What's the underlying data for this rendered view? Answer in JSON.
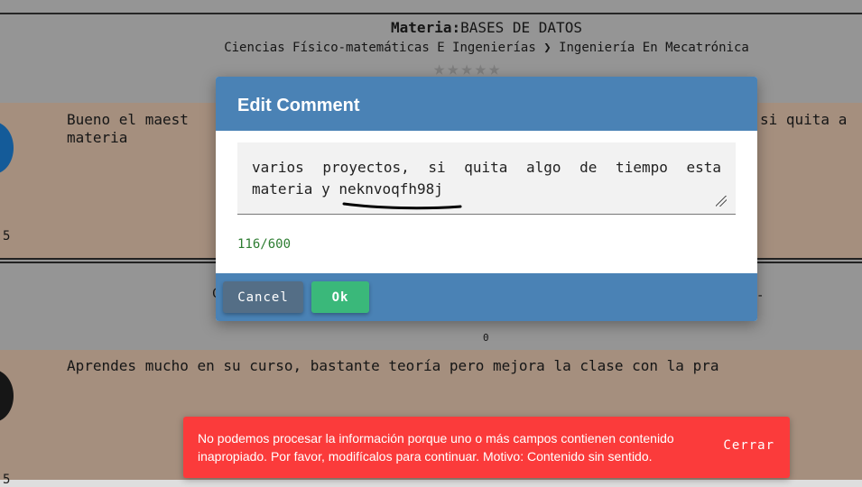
{
  "page": {
    "title_label": "Materia:",
    "title_value": "BASES DE DATOS",
    "breadcrumb_area": "Ciencias Físico-matemáticas E Ingenierías",
    "breadcrumb_sep": "❯",
    "breadcrumb_career": "Ingeniería En Mecatrónica",
    "stars": "★★★★★",
    "stars_filled": 0
  },
  "comments": [
    {
      "text_line1": "Bueno el maest",
      "text_line1_right": "si quita a",
      "text_line2": "materia",
      "rating": "5"
    },
    {
      "text_line1": "Aprendes mucho en su curso, bastante teoría pero mejora la clase con la pra",
      "rating": "5",
      "votes": "0"
    }
  ],
  "ghost": {
    "c": "C",
    "dash": "-"
  },
  "modal": {
    "title": "Edit Comment",
    "textarea_value": "varios proyectos, si quita algo de tiempo esta materia y neknvoqfh98j",
    "counter": "116/600",
    "cancel_label": "Cancel",
    "ok_label": "Ok"
  },
  "toast": {
    "message": "No podemos procesar la información porque uno o más campos contienen contenido inapropiado. Por favor, modifícalos para continuar. Motivo: Contenido sin sentido.",
    "close_label": "Cerrar"
  },
  "colors": {
    "modal_header": "#4a82b5",
    "ok_button": "#3ab87a",
    "cancel_button": "#546e86",
    "toast_bg": "#fb3b3b",
    "counter_text": "#2e7d32",
    "card_bg": "#f6d6bd"
  }
}
